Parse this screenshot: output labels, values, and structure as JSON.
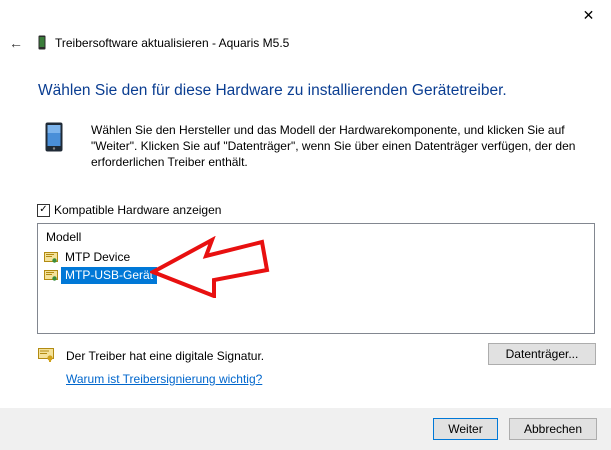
{
  "window": {
    "title": "Treibersoftware aktualisieren - Aquaris M5.5",
    "close_glyph": "✕",
    "back_glyph": "←"
  },
  "heading": "Wählen Sie den für diese Hardware zu installierenden Gerätetreiber.",
  "instructions": "Wählen Sie den Hersteller und das Modell der Hardwarekomponente, und klicken Sie auf \"Weiter\". Klicken Sie auf \"Datenträger\", wenn Sie über einen Datenträger verfügen, der den erforderlichen Treiber enthält.",
  "compatible_checkbox": {
    "label": "Kompatible Hardware anzeigen",
    "checked": true,
    "glyph": "✓"
  },
  "model_list": {
    "header": "Modell",
    "items": [
      {
        "label": "MTP Device",
        "selected": false
      },
      {
        "label": "MTP-USB-Gerät",
        "selected": true
      }
    ]
  },
  "signature": {
    "text": "Der Treiber hat eine digitale Signatur.",
    "link": "Warum ist Treibersignierung wichtig?"
  },
  "buttons": {
    "disk": "Datenträger...",
    "next": "Weiter",
    "cancel": "Abbrechen"
  },
  "colors": {
    "heading": "#0a3d91",
    "selection": "#0078d7",
    "link": "#0066cc",
    "annotation_arrow": "#e81010"
  },
  "icons": {
    "back": "back-arrow-icon",
    "close": "close-icon",
    "device": "phone-device-icon",
    "driver": "driver-certificate-icon",
    "annotation": "red-arrow-annotation"
  }
}
